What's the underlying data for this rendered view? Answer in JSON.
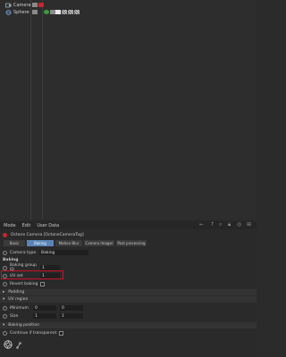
{
  "objects": [
    {
      "name": "Camera"
    },
    {
      "name": "Sphere"
    }
  ],
  "menu": [
    "Mode",
    "Edit",
    "User Data"
  ],
  "object_title": "Octane Camera [OctaneCameraTag]",
  "tabs": [
    {
      "label": "Basic",
      "active": false
    },
    {
      "label": "Baking",
      "active": true
    },
    {
      "label": "Motion Blur",
      "active": false
    },
    {
      "label": "Camera Imager",
      "active": false
    },
    {
      "label": "Post processing",
      "active": false
    }
  ],
  "camera_type": {
    "label": "Camera type",
    "value": "Baking"
  },
  "baking_header": "Baking",
  "baking_group_id": {
    "label": "Baking group ID",
    "value": "1"
  },
  "uv_set": {
    "label": "UV set",
    "value": "1"
  },
  "revert_baking": {
    "label": "Revert baking"
  },
  "padding_section": "Padding",
  "uv_region_section": "UV region",
  "minimum": {
    "label": "Minimum",
    "values": [
      "0",
      "0"
    ]
  },
  "size": {
    "label": "Size",
    "values": [
      "1",
      "1"
    ]
  },
  "baking_position_section": "Baking position",
  "continue_if_transparent": {
    "label": "Continue if transparent"
  },
  "highlight_color": "#d0102a",
  "accent_color": "#5a84b8"
}
